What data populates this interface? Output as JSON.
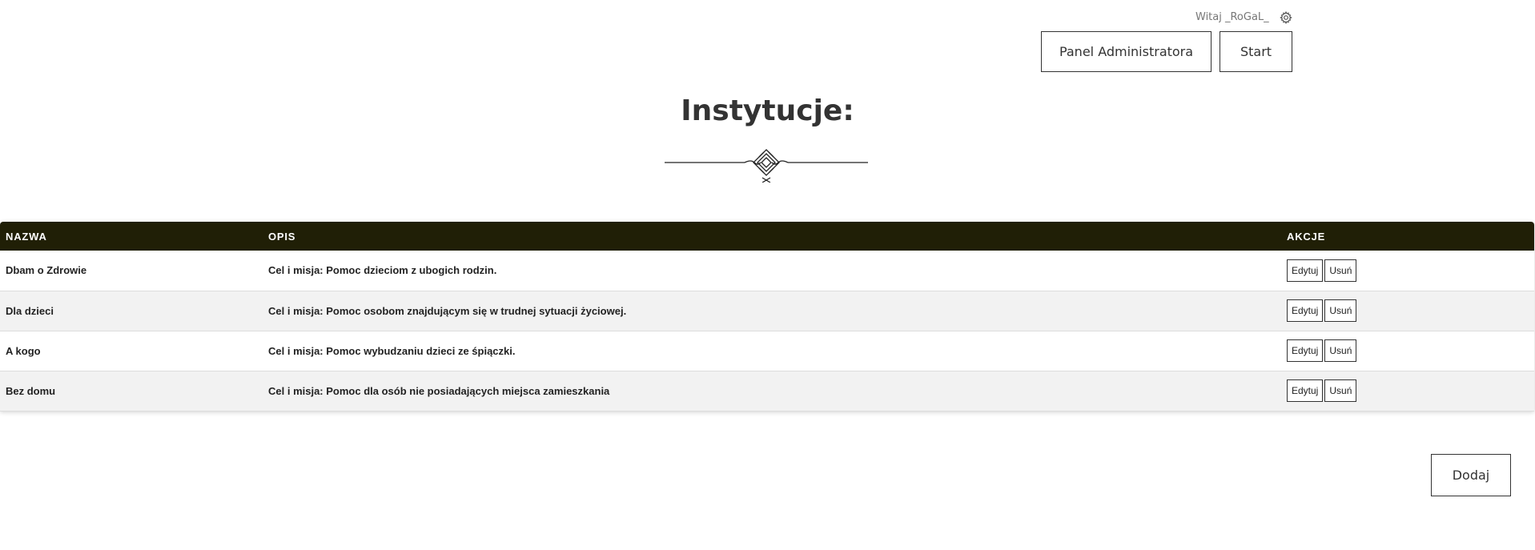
{
  "header": {
    "greeting": "Witaj _RoGaL_",
    "settings_icon": "gear-icon",
    "admin_panel_label": "Panel Administratora",
    "start_label": "Start"
  },
  "page": {
    "title": "Instytucje:"
  },
  "table": {
    "columns": [
      "NAZWA",
      "OPIS",
      "AKCJE"
    ],
    "rows": [
      {
        "name": "Dbam o Zdrowie",
        "description": "Cel i misja: Pomoc dzieciom z ubogich rodzin.",
        "edit_label": "Edytuj",
        "delete_label": "Usuń"
      },
      {
        "name": "Dla dzieci",
        "description": "Cel i misja: Pomoc osobom znajdującym się w trudnej sytuacji życiowej.",
        "edit_label": "Edytuj",
        "delete_label": "Usuń"
      },
      {
        "name": "A kogo",
        "description": "Cel i misja: Pomoc wybudzaniu dzieci ze śpiączki.",
        "edit_label": "Edytuj",
        "delete_label": "Usuń"
      },
      {
        "name": "Bez domu",
        "description": "Cel i misja: Pomoc dla osób nie posiadających miejsca zamieszkania",
        "edit_label": "Edytuj",
        "delete_label": "Usuń"
      }
    ]
  },
  "footer": {
    "add_label": "Dodaj"
  },
  "colors": {
    "table_header_bg": "#201f06",
    "row_alt_bg": "#f2f2f2",
    "text": "#333333"
  }
}
